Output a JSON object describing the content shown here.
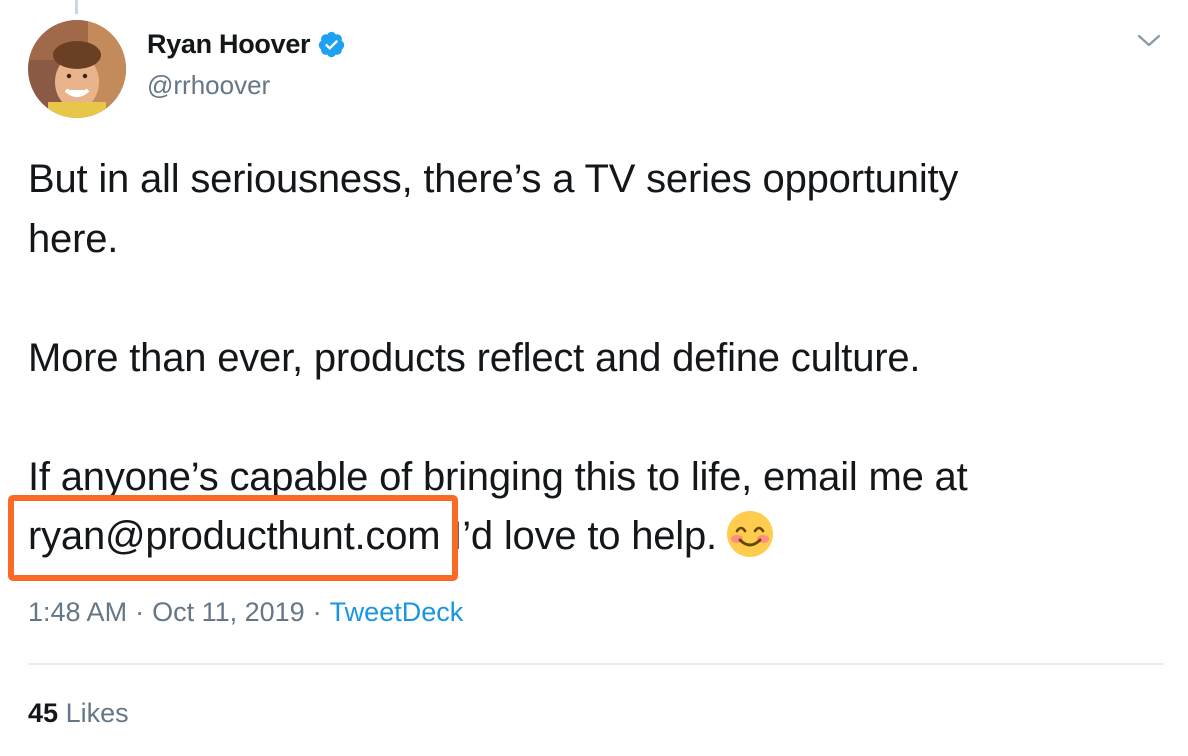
{
  "author": {
    "display_name": "Ryan Hoover",
    "handle": "@rrhoover",
    "verified": true
  },
  "tweet": {
    "line1": "But in all seriousness, there’s a TV series opportunity",
    "line2": "here.",
    "line3": "More than ever, products reflect and define culture.",
    "line4": "If anyone’s capable of bringing this to life, email me at",
    "email": "ryan@producthunt.com",
    "line5_after_email": " I’d love to help.",
    "emoji": "smiling-face-with-smiling-eyes"
  },
  "meta": {
    "time": "1:48 AM",
    "separator": "·",
    "date": "Oct 11, 2019",
    "source": "TweetDeck"
  },
  "stats": {
    "likes_count": "45",
    "likes_label": "Likes"
  },
  "colors": {
    "text": "#14171a",
    "secondary": "#657786",
    "link": "#1b95e0",
    "verified": "#1da1f2",
    "highlight": "#fa6a24",
    "divider": "#e6ecf0"
  }
}
